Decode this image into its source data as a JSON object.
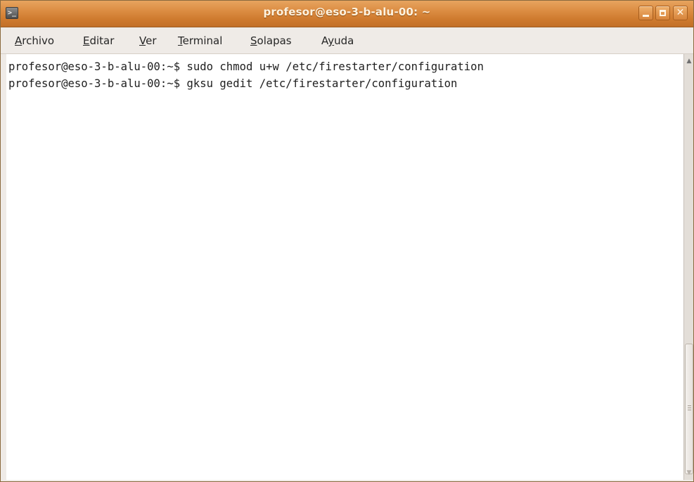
{
  "window": {
    "title": "profesor@eso-3-b-alu-00: ~",
    "icons": {
      "app": "terminal-icon",
      "minimize": "minimize-icon",
      "maximize": "maximize-icon",
      "close": "close-icon"
    }
  },
  "menu": {
    "items": [
      {
        "mnemonic": "A",
        "rest": "rchivo"
      },
      {
        "mnemonic": "E",
        "rest": "ditar"
      },
      {
        "mnemonic": "V",
        "rest": "er"
      },
      {
        "mnemonic": "T",
        "rest": "erminal"
      },
      {
        "mnemonic": "S",
        "rest": "olapas"
      },
      {
        "pre": "A",
        "mnemonic": "y",
        "rest": "uda"
      }
    ]
  },
  "terminal": {
    "lines": [
      "profesor@eso-3-b-alu-00:~$ sudo chmod u+w /etc/firestarter/configuration",
      "profesor@eso-3-b-alu-00:~$ gksu gedit /etc/firestarter/configuration"
    ]
  },
  "colors": {
    "titlebar_accent": "#dd8f45",
    "menubar_bg": "#efebe7",
    "terminal_bg": "#ffffff",
    "terminal_fg": "#1e1e1e"
  }
}
